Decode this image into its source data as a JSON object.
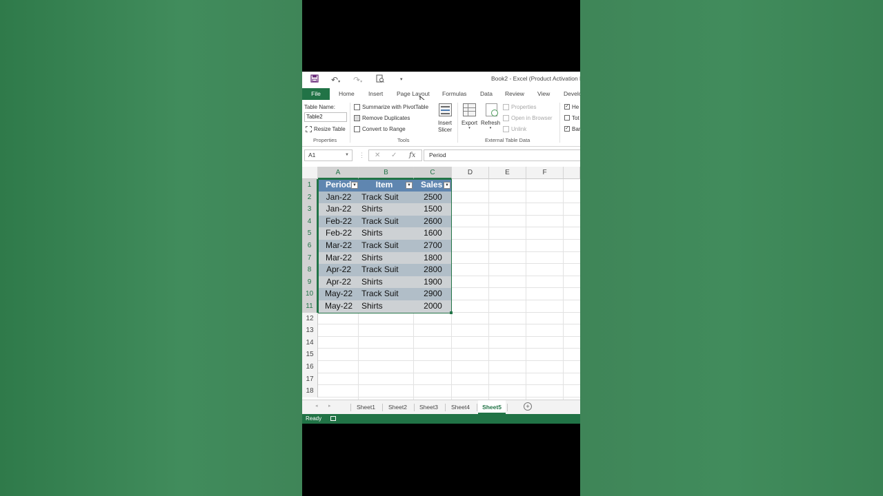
{
  "app": {
    "title": "Book2 - Excel (Product Activation F"
  },
  "ribbon_tabs": [
    "File",
    "Home",
    "Insert",
    "Page Layout",
    "Formulas",
    "Data",
    "Review",
    "View",
    "Develo"
  ],
  "ribbon": {
    "properties": {
      "table_name_label": "Table Name:",
      "table_name_value": "Table2",
      "resize_label": "Resize Table",
      "group_label": "Properties"
    },
    "tools": {
      "summarize_label": "Summarize with PivotTable",
      "remove_dup_label": "Remove Duplicates",
      "convert_label": "Convert to Range",
      "slicer_label_1": "Insert",
      "slicer_label_2": "Slicer",
      "group_label": "Tools"
    },
    "external": {
      "export_label": "Export",
      "refresh_label": "Refresh",
      "properties_label": "Properties",
      "open_browser_label": "Open in Browser",
      "unlink_label": "Unlink",
      "group_label": "External Table Data"
    },
    "style_options": {
      "header_row_label": "He",
      "total_row_label": "Tot",
      "banded_rows_label": "Bar"
    }
  },
  "formula_bar": {
    "name_box": "A1",
    "cancel_glyph": "✕",
    "enter_glyph": "✓",
    "fx_glyph": "fx",
    "value": "Period"
  },
  "columns": [
    "A",
    "B",
    "C",
    "D",
    "E",
    "F"
  ],
  "rows": [
    "1",
    "2",
    "3",
    "4",
    "5",
    "6",
    "7",
    "8",
    "9",
    "10",
    "11",
    "12",
    "13",
    "14",
    "15",
    "16",
    "17",
    "18"
  ],
  "table": {
    "headers": [
      "Period",
      "Item",
      "Sales"
    ],
    "rows": [
      [
        "Jan-22",
        "Track Suit",
        "2500"
      ],
      [
        "Jan-22",
        "Shirts",
        "1500"
      ],
      [
        "Feb-22",
        "Track Suit",
        "2600"
      ],
      [
        "Feb-22",
        "Shirts",
        "1600"
      ],
      [
        "Mar-22",
        "Track Suit",
        "2700"
      ],
      [
        "Mar-22",
        "Shirts",
        "1800"
      ],
      [
        "Apr-22",
        "Track Suit",
        "2800"
      ],
      [
        "Apr-22",
        "Shirts",
        "1900"
      ],
      [
        "May-22",
        "Track Suit",
        "2900"
      ],
      [
        "May-22",
        "Shirts",
        "2000"
      ]
    ]
  },
  "sheet_tabs": [
    "Sheet1",
    "Sheet2",
    "Sheet3",
    "Sheet4",
    "Sheet5"
  ],
  "active_sheet": "Sheet5",
  "status": {
    "ready": "Ready"
  },
  "colors": {
    "excel_green": "#217346",
    "table_header": "#5f86b0",
    "band_dark": "#b1bec8",
    "band_light": "#cdd1d4",
    "background": "#3f8558"
  }
}
